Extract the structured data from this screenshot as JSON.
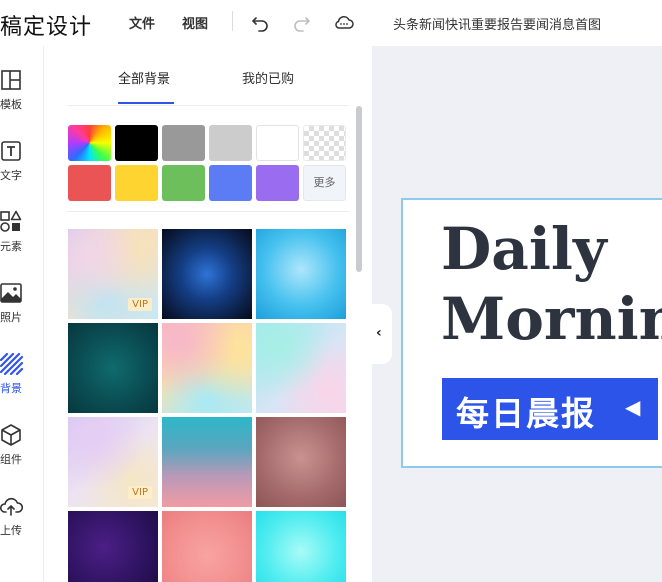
{
  "header": {
    "brand": "稿定设计",
    "menu": [
      "文件",
      "视图"
    ],
    "icons": [
      "undo-icon",
      "redo-icon",
      "cloud-icon"
    ],
    "doc_title": "头条新闻快讯重要报告要闻消息首图"
  },
  "sidebar": {
    "items": [
      {
        "label": "模板",
        "icon": "template-icon"
      },
      {
        "label": "文字",
        "icon": "text-icon"
      },
      {
        "label": "元素",
        "icon": "elements-icon"
      },
      {
        "label": "照片",
        "icon": "photo-icon"
      },
      {
        "label": "背景",
        "icon": "background-icon",
        "active": true
      },
      {
        "label": "组件",
        "icon": "component-icon"
      },
      {
        "label": "上传",
        "icon": "upload-icon"
      }
    ]
  },
  "panel": {
    "tabs": [
      {
        "label": "全部背景",
        "active": true
      },
      {
        "label": "我的已购",
        "active": false
      }
    ],
    "swatches": [
      {
        "name": "rainbow",
        "color": "rainbow"
      },
      {
        "name": "black",
        "color": "#000000"
      },
      {
        "name": "gray",
        "color": "#999999"
      },
      {
        "name": "light-gray",
        "color": "#cccccc"
      },
      {
        "name": "white",
        "color": "#ffffff"
      },
      {
        "name": "transparent",
        "color": "transparent"
      },
      {
        "name": "red",
        "color": "#ea5455"
      },
      {
        "name": "yellow",
        "color": "#fdd430"
      },
      {
        "name": "green",
        "color": "#6cbf5a"
      },
      {
        "name": "blue",
        "color": "#5b7cf5"
      },
      {
        "name": "purple",
        "color": "#9a6cf0"
      }
    ],
    "more_label": "更多",
    "vip_label": "VIP",
    "backgrounds": [
      {
        "vip": true
      },
      {
        "vip": false
      },
      {
        "vip": false
      },
      {
        "vip": false
      },
      {
        "vip": false
      },
      {
        "vip": false
      },
      {
        "vip": true
      },
      {
        "vip": false
      },
      {
        "vip": false
      },
      {
        "vip": false
      },
      {
        "vip": false
      },
      {
        "vip": false
      }
    ]
  },
  "canvas": {
    "collapse_icon": "chevron-left-icon",
    "title_line1": "Daily",
    "title_line2": "Mornin",
    "banner_text": "每日晨报",
    "banner_icon": "caret-left-icon"
  },
  "colors": {
    "accent": "#2f54eb",
    "banner": "#2d54e8",
    "card_border": "#8ec9ef",
    "canvas_bg": "#eef0f6"
  }
}
